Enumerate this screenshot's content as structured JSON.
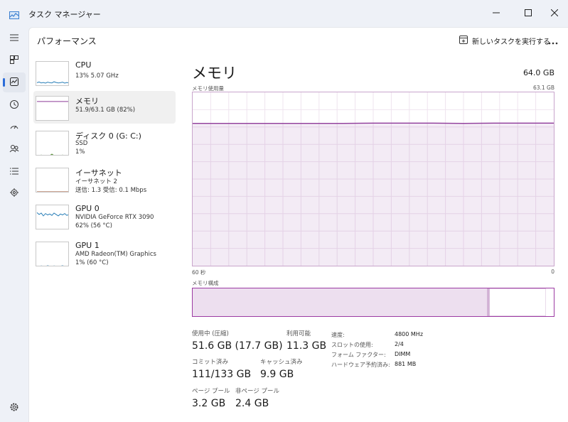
{
  "window": {
    "title": "タスク マネージャー"
  },
  "header": {
    "page_title": "パフォーマンス",
    "new_task_label": "新しいタスクを実行する"
  },
  "sidebar": {
    "items": [
      {
        "name": "CPU",
        "line1": "13%  5.07 GHz",
        "line2": "",
        "color": "#2a7fb8",
        "values": [
          14,
          17,
          13,
          15,
          12,
          16,
          14,
          13,
          18,
          15,
          13,
          14,
          16,
          12,
          15,
          13
        ]
      },
      {
        "name": "メモリ",
        "line1": "51.9/63.1 GB (82%)",
        "line2": "",
        "color": "#8e3a99",
        "values": [
          82,
          82,
          82,
          82,
          82,
          82,
          82,
          82,
          82,
          82,
          82,
          82,
          82,
          82,
          82,
          82
        ]
      },
      {
        "name": "ディスク 0 (G: C:)",
        "line1": "SSD",
        "line2": "1%",
        "color": "#4e8a2c",
        "values": [
          0,
          0,
          2,
          0,
          0,
          1,
          0,
          6,
          0,
          1,
          0,
          0,
          2,
          0,
          0,
          1
        ]
      },
      {
        "name": "イーサネット",
        "line1": "イーサネット 2",
        "line2": "送信: 1.3  受信: 0.1 Mbps",
        "color": "#a0522d",
        "values": [
          3,
          3,
          3,
          3,
          3,
          3,
          3,
          3,
          3,
          3,
          3,
          3,
          3,
          3,
          3,
          3
        ]
      },
      {
        "name": "GPU 0",
        "line1": "NVIDIA GeForce RTX 3090",
        "line2": "62% (56 °C)",
        "color": "#2a7fb8",
        "values": [
          72,
          64,
          70,
          58,
          68,
          62,
          66,
          60,
          70,
          64,
          58,
          66,
          62,
          68,
          60,
          64
        ]
      },
      {
        "name": "GPU 1",
        "line1": "AMD Radeon(TM) Graphics",
        "line2": "1% (60 °C)",
        "color": "#2a7fb8",
        "values": [
          1,
          0,
          2,
          1,
          0,
          3,
          1,
          0,
          2,
          1,
          0,
          1,
          3,
          0,
          1,
          2
        ]
      }
    ]
  },
  "memory": {
    "title": "メモリ",
    "total": "64.0 GB",
    "usage_label": "メモリ使用量",
    "usage_max": "63.1 GB",
    "time_left": "60 秒",
    "time_right": "0",
    "composition_label": "メモリ構成",
    "stats": {
      "in_use_label": "使用中 (圧縮)",
      "in_use_value": "51.6 GB (17.7 GB)",
      "available_label": "利用可能",
      "available_value": "11.3 GB",
      "committed_label": "コミット済み",
      "committed_value": "111/133 GB",
      "cached_label": "キャッシュ済み",
      "cached_value": "9.9 GB",
      "paged_label": "ページ プール",
      "paged_value": "3.2 GB",
      "nonpaged_label": "非ページ プール",
      "nonpaged_value": "2.4 GB"
    },
    "details": [
      {
        "label": "速度:",
        "value": "4800 MHz"
      },
      {
        "label": "スロットの使用:",
        "value": "2/4"
      },
      {
        "label": "フォーム ファクター:",
        "value": "DIMM"
      },
      {
        "label": "ハードウェア予約済み:",
        "value": "881 MB"
      }
    ]
  },
  "chart_data": {
    "type": "area",
    "title": "メモリ使用量",
    "x": [
      60,
      55,
      50,
      45,
      40,
      35,
      30,
      25,
      20,
      15,
      10,
      5,
      0
    ],
    "series": [
      {
        "values": [
          51.8,
          51.8,
          51.8,
          51.8,
          51.8,
          51.8,
          51.9,
          51.9,
          51.9,
          51.8,
          51.9,
          51.9,
          51.9
        ]
      }
    ],
    "ylim": [
      0,
      63.1
    ],
    "xlim": [
      60,
      0
    ],
    "grid": true,
    "color": "#8e3a99",
    "composition": {
      "in_use": 51.6,
      "modified": 0.3,
      "standby": 9.9,
      "free": 1.4
    }
  }
}
